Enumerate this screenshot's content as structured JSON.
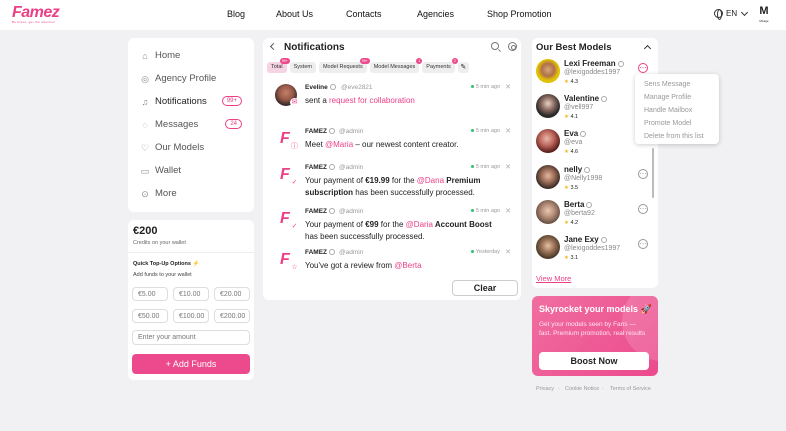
{
  "brand": {
    "logo": "Famez",
    "tagline": "Be brave, get the attention",
    "corner_logo": "M",
    "corner_logo_sub": "Mirage"
  },
  "nav": {
    "blog": "Blog",
    "about": "About Us",
    "contacts": "Contacts",
    "agencies": "Agencies",
    "shop": "Shop Promotion",
    "lang": "EN"
  },
  "sidebar": {
    "items": [
      {
        "label": "Home",
        "icon": "home-icon"
      },
      {
        "label": "Agency Profile",
        "icon": "agency-icon"
      },
      {
        "label": "Notifications",
        "icon": "bell-icon",
        "badge": "99+"
      },
      {
        "label": "Messages",
        "icon": "chat-icon",
        "badge": "24"
      },
      {
        "label": "Our Models",
        "icon": "heart-icon"
      },
      {
        "label": "Wallet",
        "icon": "wallet-icon"
      },
      {
        "label": "More",
        "icon": "more-icon"
      }
    ]
  },
  "wallet": {
    "amount": "€200",
    "caption": "Credits on your wallet",
    "quick_title": "Quick Top-Up Options ⚡",
    "quick_sub": "Add funds to your wallet",
    "options": [
      "€5.00",
      "€10.00",
      "€20.00",
      "€50.00",
      "€100.00",
      "€200.00"
    ],
    "placeholder": "Enter your amount",
    "add_label": "+ Add Funds"
  },
  "notifications": {
    "title": "Notifications",
    "tabs": [
      {
        "label": "Total",
        "count": "99+"
      },
      {
        "label": "System",
        "count": ""
      },
      {
        "label": "Model Requests",
        "count": "99+"
      },
      {
        "label": "Model Messages",
        "count": "1"
      },
      {
        "label": "Payments",
        "count": "2"
      }
    ],
    "items": [
      {
        "name": "Eveline",
        "handle": "@eve2821",
        "time": "5 min ago",
        "pre": "sent a ",
        "link": "request for collaboration",
        "post": "",
        "sub_icon": "✉"
      },
      {
        "name": "FAMEZ",
        "handle": "@admin",
        "time": "5 min ago",
        "pre": "Meet ",
        "link": "@Maria",
        "post": " – our newest content creator.",
        "sub_icon": "ⓘ"
      },
      {
        "name": "FAMEZ",
        "handle": "@admin",
        "time": "5 min ago",
        "pre": "Your payment of ",
        "amount": "€19.99",
        "mid": " for the ",
        "link": "@Dana",
        "strong": " Premium subscription",
        "post": " has been successfully processed.",
        "sub_icon": "✓"
      },
      {
        "name": "FAMEZ",
        "handle": "@admin",
        "time": "5 min ago",
        "pre": "Your payment of ",
        "amount": "€99",
        "mid": " for the ",
        "link": "@Daria",
        "strong": " Account Boost",
        "post": " has been successfully processed.",
        "sub_icon": "✓"
      },
      {
        "name": "FAMEZ",
        "handle": "@admin",
        "time": "Yesterday",
        "pre": "You've got a review from ",
        "link": "@Berta",
        "post": "",
        "sub_icon": "☆"
      }
    ],
    "clear_label": "Clear"
  },
  "models": {
    "title": "Our Best Models",
    "items": [
      {
        "name": "Lexi Freeman",
        "handle": "@lexigoddes1997",
        "rating": "4.3"
      },
      {
        "name": "Valentine",
        "handle": "@vell997",
        "rating": "4.1"
      },
      {
        "name": "Eva",
        "handle": "@eva",
        "rating": "4.6"
      },
      {
        "name": "nelly",
        "handle": "@Nelly1998",
        "rating": "3.5"
      },
      {
        "name": "Berta",
        "handle": "@berta92",
        "rating": "4.2"
      },
      {
        "name": "Jane Exy",
        "handle": "@lexigoddes1997",
        "rating": "3.1"
      }
    ],
    "view_more": "View More",
    "menu": [
      "Sens Message",
      "Manage Profile",
      "Handle Mailbox",
      "Promote Model",
      "Delete from this list"
    ]
  },
  "promo": {
    "title": "Skyrocket your models 🚀",
    "text": "Get your models seen by Fans — fast. Premium promotion, real results",
    "button": "Boost Now"
  },
  "footer": {
    "privacy": "Privacy",
    "cookie": "Cookie Notice",
    "terms": "Terms of Service"
  },
  "colors": {
    "accent": "#ec3f86",
    "accent_btn": "#ec4a8d",
    "online": "#2fbf71",
    "background": "#f1f1f3"
  }
}
